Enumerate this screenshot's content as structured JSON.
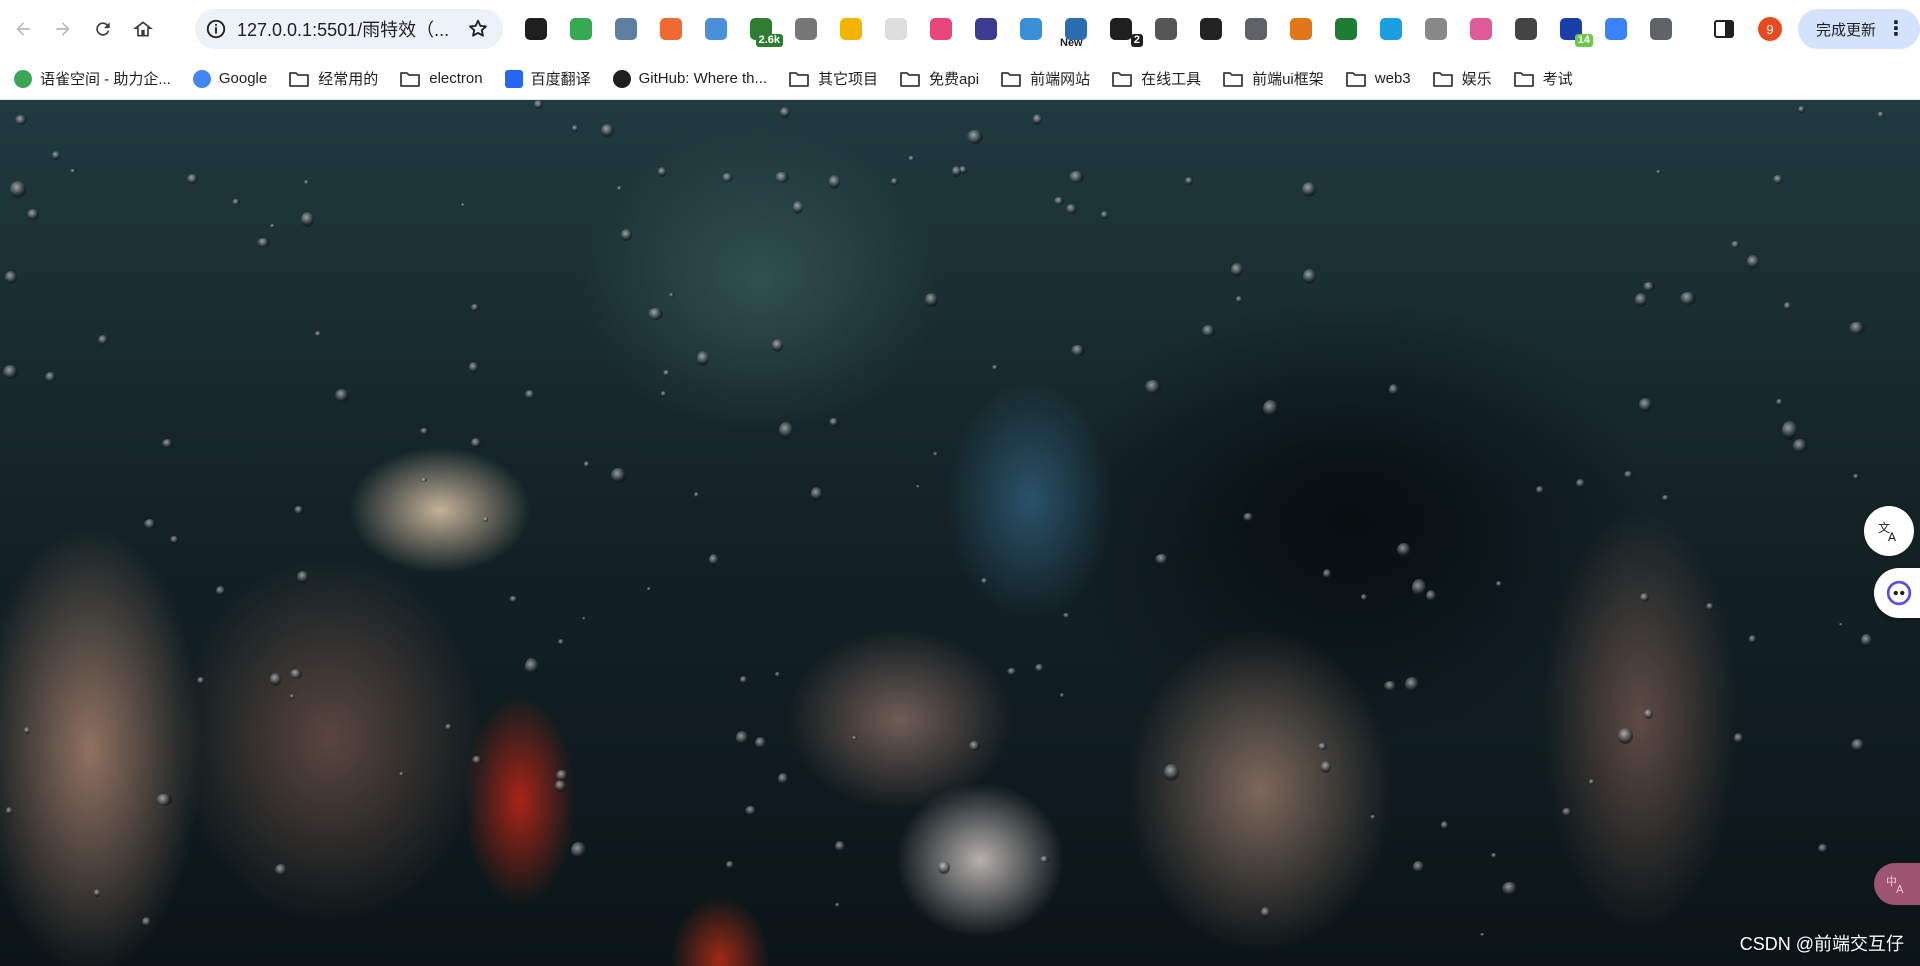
{
  "browser": {
    "url": "127.0.0.1:5501/雨特效（...",
    "extensions": [
      {
        "icon": "ghost-icon",
        "color": "#1f1f1f",
        "badge": ""
      },
      {
        "icon": "shield-icon",
        "color": "#34a853",
        "badge": ""
      },
      {
        "icon": "star-box-icon",
        "color": "#5f7fa0",
        "badge": ""
      },
      {
        "icon": "paint-icon",
        "color": "#ee6a32",
        "badge": ""
      },
      {
        "icon": "colorful-icon",
        "color": "#4a90d9",
        "badge": ""
      },
      {
        "icon": "android-icon",
        "color": "#2e7d32",
        "badge": "2.6k"
      },
      {
        "icon": "face-icon",
        "color": "#777777",
        "badge": ""
      },
      {
        "icon": "chrome-ring-icon",
        "color": "#f2b400",
        "badge": ""
      },
      {
        "icon": "blank-icon",
        "color": "#dddddd",
        "badge": ""
      },
      {
        "icon": "translate-pink-icon",
        "color": "#e8457c",
        "badge": ""
      },
      {
        "icon": "robot-face-icon",
        "color": "#3b3b8f",
        "badge": ""
      },
      {
        "icon": "screenshot-icon",
        "color": "#3a8fd9",
        "badge": ""
      },
      {
        "icon": "new-icon",
        "color": "#2a6db0",
        "badge": "New"
      },
      {
        "icon": "edit-icon",
        "color": "#1f1f1f",
        "badge": "2"
      },
      {
        "icon": "y-icon",
        "color": "#555555",
        "badge": ""
      },
      {
        "icon": "aperture-icon",
        "color": "#222222",
        "badge": ""
      },
      {
        "icon": "copy-icon",
        "color": "#5f6368",
        "badge": ""
      },
      {
        "icon": "fox-icon",
        "color": "#e2761b",
        "badge": ""
      },
      {
        "icon": "download-arrow-icon",
        "color": "#1e7d32",
        "badge": ""
      },
      {
        "icon": "eye-icon",
        "color": "#1a9fe0",
        "badge": ""
      },
      {
        "icon": "n-icon",
        "color": "#888888",
        "badge": ""
      },
      {
        "icon": "fireworks-icon",
        "color": "#e05a9a",
        "badge": ""
      },
      {
        "icon": "a-icon",
        "color": "#444444",
        "badge": ""
      },
      {
        "icon": "calendar-icon",
        "color": "#1a3fa8",
        "badge": "14"
      },
      {
        "icon": "person-box-icon",
        "color": "#3b82f6",
        "badge": ""
      },
      {
        "icon": "puzzle-icon",
        "color": "#5f6368",
        "badge": ""
      }
    ],
    "avatar_text": "9",
    "update_label": "完成更新"
  },
  "bookmarks": [
    {
      "type": "link",
      "icon": "leaf-icon",
      "color": "#3aa757",
      "label": "语雀空间 - 助力企..."
    },
    {
      "type": "link",
      "icon": "google-icon",
      "color": "#4285f4",
      "label": "Google"
    },
    {
      "type": "folder",
      "label": "经常用的"
    },
    {
      "type": "folder",
      "label": "electron"
    },
    {
      "type": "link",
      "icon": "translate-icon",
      "color": "#2468f2",
      "label": "百度翻译"
    },
    {
      "type": "link",
      "icon": "github-icon",
      "color": "#1f1f1f",
      "label": "GitHub: Where th..."
    },
    {
      "type": "folder",
      "label": "其它项目"
    },
    {
      "type": "folder",
      "label": "免费api"
    },
    {
      "type": "folder",
      "label": "前端网站"
    },
    {
      "type": "folder",
      "label": "在线工具"
    },
    {
      "type": "folder",
      "label": "前端ui框架"
    },
    {
      "type": "folder",
      "label": "web3"
    },
    {
      "type": "folder",
      "label": "娱乐"
    },
    {
      "type": "folder",
      "label": "考试"
    }
  ],
  "page": {
    "watermark": "CSDN @前端交互仔"
  }
}
